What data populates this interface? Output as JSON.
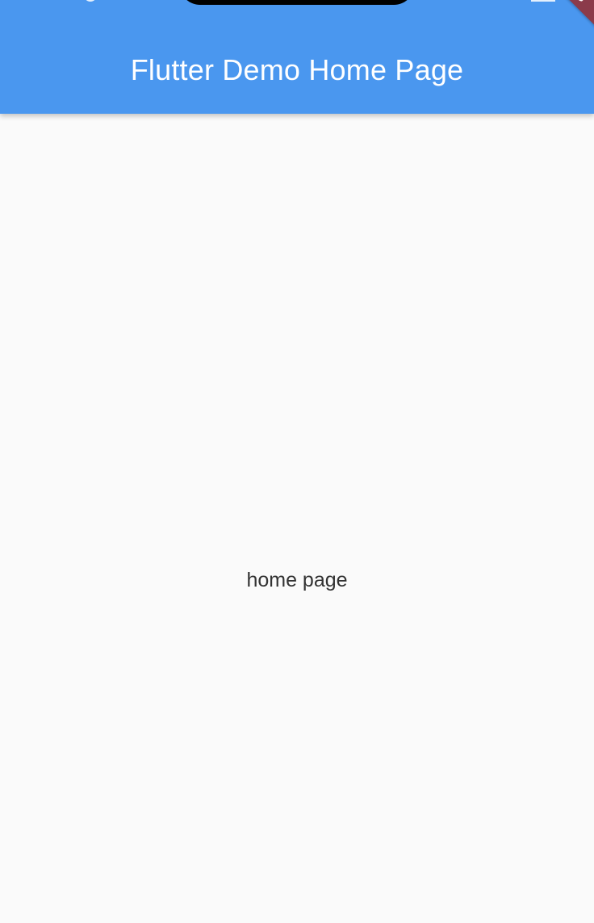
{
  "app_bar": {
    "title": "Flutter Demo Home Page",
    "background_color": "#4A97EF",
    "title_color": "#FFFFFF"
  },
  "debug_banner": {
    "label": "DEBUG",
    "visible_label": "UG",
    "color": "#8B3B4A"
  },
  "body": {
    "text": "home page",
    "background_color": "#FAFAFA",
    "text_color": "#333333"
  }
}
